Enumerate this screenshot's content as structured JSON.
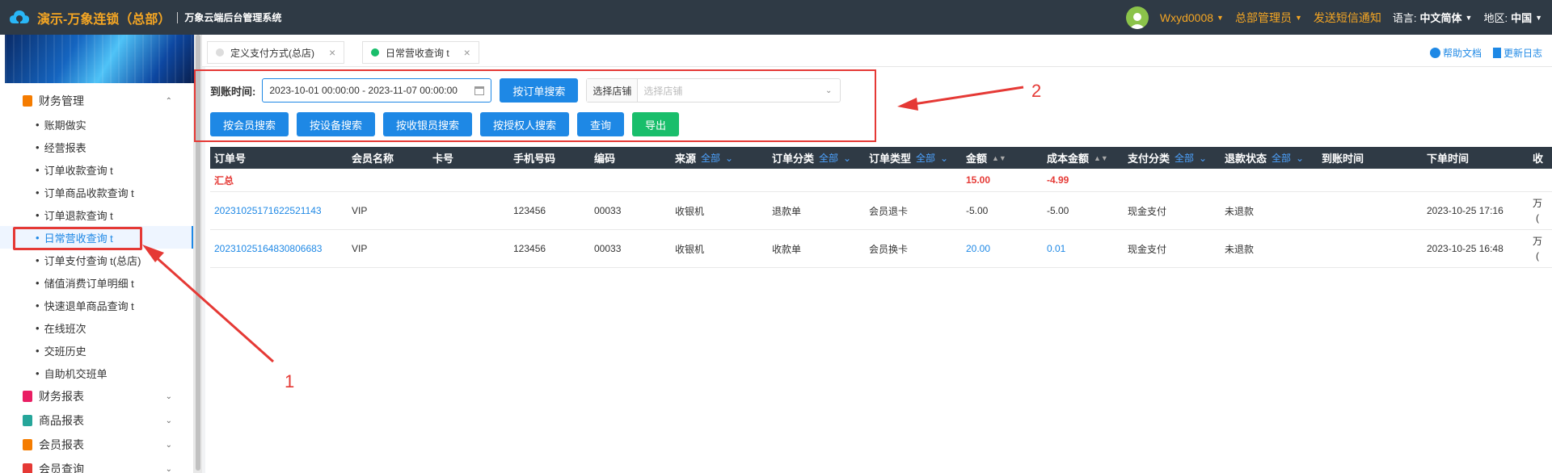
{
  "topbar": {
    "app_title": "演示-万象连锁（总部）",
    "system_name": "万象云端后台管理系统",
    "username": "Wxyd0008",
    "role": "总部管理员",
    "sms_notice": "发送短信通知",
    "language_label": "语言:",
    "language_value": "中文简体",
    "region_label": "地区:",
    "region_value": "中国"
  },
  "sidebar": {
    "groups": [
      {
        "label": "财务管理",
        "icon_color": "#f57c00",
        "expanded": true
      },
      {
        "label": "财务报表",
        "icon_color": "#e91e63"
      },
      {
        "label": "商品报表",
        "icon_color": "#26a69a"
      },
      {
        "label": "会员报表",
        "icon_color": "#f57c00"
      },
      {
        "label": "会员查询",
        "icon_color": "#e53935"
      }
    ],
    "items": [
      "账期做实",
      "经营报表",
      "订单收款查询 t",
      "订单商品收款查询 t",
      "订单退款查询 t",
      "日常营收查询 t",
      "订单支付查询 t(总店)",
      "储值消费订单明细 t",
      "快速退单商品查询 t",
      "在线班次",
      "交班历史",
      "自助机交班单"
    ],
    "active_index": 5,
    "bullet": "•"
  },
  "tabs": [
    {
      "label": "定义支付方式(总店)",
      "dot_color": "#dddddd"
    },
    {
      "label": "日常营收查询 t",
      "dot_color": "#19be6b"
    }
  ],
  "tab_close": "×",
  "links": {
    "help": "帮助文档",
    "changelog": "更新日志"
  },
  "filter": {
    "date_label": "到账时间:",
    "date_value": "2023-10-01 00:00:00 - 2023-11-07 00:00:00",
    "order_search": "按订单搜索",
    "store_label": "选择店铺",
    "store_placeholder": "选择店铺",
    "buttons": [
      "按会员搜索",
      "按设备搜索",
      "按收银员搜索",
      "按授权人搜索",
      "查询",
      "导出"
    ]
  },
  "table": {
    "all_label": "全部",
    "columns": [
      "订单号",
      "会员名称",
      "卡号",
      "手机号码",
      "编码",
      "来源",
      "订单分类",
      "订单类型",
      "金额",
      "成本金额",
      "支付分类",
      "退款状态",
      "到账时间",
      "下单时间",
      "收"
    ],
    "summary": {
      "label": "汇总",
      "amount": "15.00",
      "cost": "-4.99"
    },
    "rows": [
      {
        "order_no": "20231025171622521143",
        "member": "VIP",
        "card": "",
        "phone": "123456",
        "code": "00033",
        "source": "收银机",
        "category": "退款单",
        "type": "会员退卡",
        "amount": "-5.00",
        "cost": "-5.00",
        "pay": "现金支付",
        "refund": "未退款",
        "arrival": "",
        "order_time": "2023-10-25 17:16",
        "extra_top": "万",
        "extra_bottom": "("
      },
      {
        "order_no": "20231025164830806683",
        "member": "VIP",
        "card": "",
        "phone": "123456",
        "code": "00033",
        "source": "收银机",
        "category": "收款单",
        "type": "会员换卡",
        "amount": "20.00",
        "cost": "0.01",
        "pay": "现金支付",
        "refund": "未退款",
        "arrival": "",
        "order_time": "2023-10-25 16:48",
        "extra_top": "万",
        "extra_bottom": "("
      }
    ]
  },
  "annotations": {
    "one": "1",
    "two": "2"
  }
}
